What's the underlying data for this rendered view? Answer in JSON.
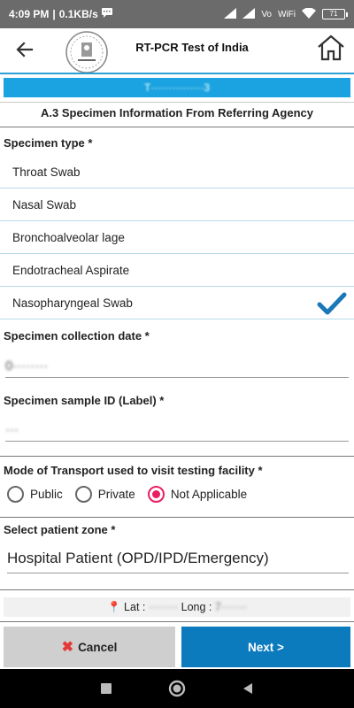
{
  "status_bar": {
    "time": "4:09 PM",
    "speed": "0.1KB/s",
    "network_labels": [
      "Vo",
      "WiFi"
    ],
    "battery": "71"
  },
  "app_bar": {
    "title": "RT-PCR Test of India",
    "back_icon": "arrow-left-icon",
    "home_icon": "home-icon",
    "logo": "icmr-emblem"
  },
  "banner": {
    "text": "T···············3"
  },
  "section": {
    "title": "A.3 Specimen Information From Referring Agency"
  },
  "specimen_type": {
    "label": "Specimen type *",
    "options": [
      "Throat Swab",
      "Nasal Swab",
      "Bronchoalveolar lage",
      "Endotracheal Aspirate",
      "Nasopharyngeal Swab"
    ],
    "selected": "Nasopharyngeal Swab"
  },
  "collection_date": {
    "label": "Specimen collection date *",
    "value": "0········"
  },
  "sample_id": {
    "label": "Specimen sample ID (Label) *",
    "value": "···"
  },
  "transport": {
    "label": "Mode of Transport used to visit testing facility *",
    "options": [
      "Public",
      "Private",
      "Not Applicable"
    ],
    "selected": "Not Applicable"
  },
  "patient_zone": {
    "label": "Select patient zone *",
    "value": "Hospital Patient (OPD/IPD/Emergency)"
  },
  "location": {
    "lat_label": "Lat :",
    "lat_value": "········",
    "long_label": "Long :",
    "long_value": "7·······"
  },
  "buttons": {
    "cancel": "Cancel",
    "next": "Next >"
  },
  "colors": {
    "accent_blue": "#1aa3e0",
    "next_button": "#0b7bbd",
    "radio_selected": "#e91e63",
    "check": "#1a77b8"
  }
}
